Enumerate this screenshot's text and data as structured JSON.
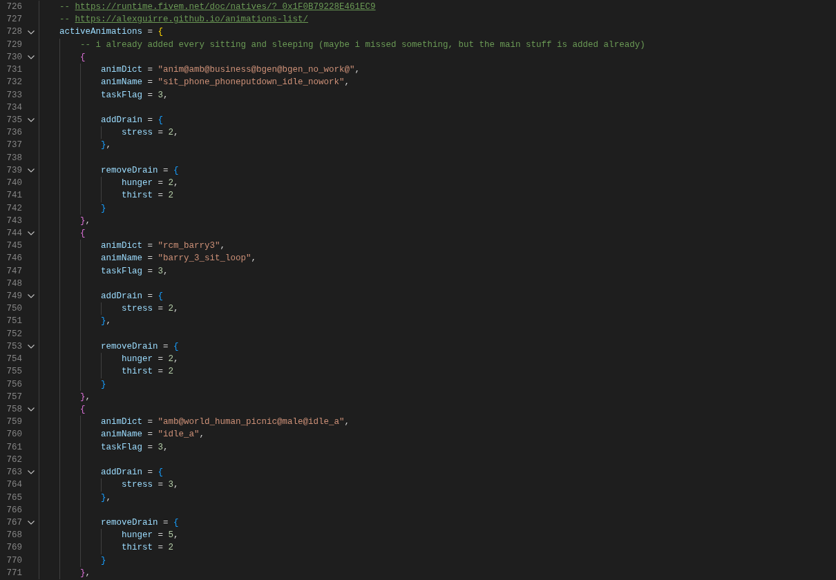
{
  "editor": {
    "lines": [
      {
        "number": "726",
        "foldable": false,
        "tokens": [
          {
            "kind": "comment",
            "text": "-- "
          },
          {
            "kind": "link",
            "text": "https://runtime.fivem.net/doc/natives/?_0x1F0B79228E461EC9"
          }
        ]
      },
      {
        "number": "727",
        "foldable": false,
        "tokens": [
          {
            "kind": "comment",
            "text": "-- "
          },
          {
            "kind": "link",
            "text": "https://alexguirre.github.io/animations-list/"
          }
        ]
      },
      {
        "number": "728",
        "foldable": true,
        "tokens": [
          {
            "kind": "key",
            "text": "activeAnimations"
          },
          {
            "kind": "op",
            "text": " = "
          },
          {
            "kind": "brace1",
            "text": "{"
          }
        ],
        "children": [
          {
            "number": "729",
            "foldable": false,
            "tokens": [
              {
                "kind": "comment",
                "text": "-- i already added every sitting and sleeping (maybe i missed something, but the main stuff is added already)"
              }
            ]
          },
          {
            "number": "730",
            "foldable": true,
            "tokens": [
              {
                "kind": "brace2",
                "text": "{"
              }
            ],
            "children": [
              {
                "number": "731",
                "foldable": false,
                "tokens": [
                  {
                    "kind": "key",
                    "text": "animDict"
                  },
                  {
                    "kind": "op",
                    "text": " = "
                  },
                  {
                    "kind": "string",
                    "text": "\"anim@amb@business@bgen@bgen_no_work@\""
                  },
                  {
                    "kind": "op",
                    "text": ","
                  }
                ]
              },
              {
                "number": "732",
                "foldable": false,
                "tokens": [
                  {
                    "kind": "key",
                    "text": "animName"
                  },
                  {
                    "kind": "op",
                    "text": " = "
                  },
                  {
                    "kind": "string",
                    "text": "\"sit_phone_phoneputdown_idle_nowork\""
                  },
                  {
                    "kind": "op",
                    "text": ","
                  }
                ]
              },
              {
                "number": "733",
                "foldable": false,
                "tokens": [
                  {
                    "kind": "key",
                    "text": "taskFlag"
                  },
                  {
                    "kind": "op",
                    "text": " = "
                  },
                  {
                    "kind": "number",
                    "text": "3"
                  },
                  {
                    "kind": "op",
                    "text": ","
                  }
                ]
              },
              {
                "number": "734",
                "foldable": false
              },
              {
                "number": "735",
                "foldable": true,
                "tokens": [
                  {
                    "kind": "key",
                    "text": "addDrain"
                  },
                  {
                    "kind": "op",
                    "text": " = "
                  },
                  {
                    "kind": "brace3",
                    "text": "{"
                  }
                ],
                "children": [
                  {
                    "number": "736",
                    "foldable": false,
                    "tokens": [
                      {
                        "kind": "key",
                        "text": "stress"
                      },
                      {
                        "kind": "op",
                        "text": " = "
                      },
                      {
                        "kind": "number",
                        "text": "2"
                      },
                      {
                        "kind": "op",
                        "text": ","
                      }
                    ]
                  }
                ]
              },
              {
                "number": "737",
                "foldable": false,
                "tokens": [
                  {
                    "kind": "brace3",
                    "text": "}"
                  },
                  {
                    "kind": "op",
                    "text": ","
                  }
                ]
              },
              {
                "number": "738",
                "foldable": false
              },
              {
                "number": "739",
                "foldable": true,
                "tokens": [
                  {
                    "kind": "key",
                    "text": "removeDrain"
                  },
                  {
                    "kind": "op",
                    "text": " = "
                  },
                  {
                    "kind": "brace3",
                    "text": "{"
                  }
                ],
                "children": [
                  {
                    "number": "740",
                    "foldable": false,
                    "tokens": [
                      {
                        "kind": "key",
                        "text": "hunger"
                      },
                      {
                        "kind": "op",
                        "text": " = "
                      },
                      {
                        "kind": "number",
                        "text": "2"
                      },
                      {
                        "kind": "op",
                        "text": ","
                      }
                    ]
                  },
                  {
                    "number": "741",
                    "foldable": false,
                    "tokens": [
                      {
                        "kind": "key",
                        "text": "thirst"
                      },
                      {
                        "kind": "op",
                        "text": " = "
                      },
                      {
                        "kind": "number",
                        "text": "2"
                      }
                    ]
                  }
                ]
              },
              {
                "number": "742",
                "foldable": false,
                "tokens": [
                  {
                    "kind": "brace3",
                    "text": "}"
                  }
                ]
              }
            ]
          },
          {
            "number": "743",
            "foldable": false,
            "tokens": [
              {
                "kind": "brace2",
                "text": "}"
              },
              {
                "kind": "op",
                "text": ","
              }
            ]
          },
          {
            "number": "744",
            "foldable": true,
            "tokens": [
              {
                "kind": "brace2",
                "text": "{"
              }
            ],
            "children": [
              {
                "number": "745",
                "foldable": false,
                "tokens": [
                  {
                    "kind": "key",
                    "text": "animDict"
                  },
                  {
                    "kind": "op",
                    "text": " = "
                  },
                  {
                    "kind": "string",
                    "text": "\"rcm_barry3\""
                  },
                  {
                    "kind": "op",
                    "text": ","
                  }
                ]
              },
              {
                "number": "746",
                "foldable": false,
                "tokens": [
                  {
                    "kind": "key",
                    "text": "animName"
                  },
                  {
                    "kind": "op",
                    "text": " = "
                  },
                  {
                    "kind": "string",
                    "text": "\"barry_3_sit_loop\""
                  },
                  {
                    "kind": "op",
                    "text": ","
                  }
                ]
              },
              {
                "number": "747",
                "foldable": false,
                "tokens": [
                  {
                    "kind": "key",
                    "text": "taskFlag"
                  },
                  {
                    "kind": "op",
                    "text": " = "
                  },
                  {
                    "kind": "number",
                    "text": "3"
                  },
                  {
                    "kind": "op",
                    "text": ","
                  }
                ]
              },
              {
                "number": "748",
                "foldable": false
              },
              {
                "number": "749",
                "foldable": true,
                "tokens": [
                  {
                    "kind": "key",
                    "text": "addDrain"
                  },
                  {
                    "kind": "op",
                    "text": " = "
                  },
                  {
                    "kind": "brace3",
                    "text": "{"
                  }
                ],
                "children": [
                  {
                    "number": "750",
                    "foldable": false,
                    "tokens": [
                      {
                        "kind": "key",
                        "text": "stress"
                      },
                      {
                        "kind": "op",
                        "text": " = "
                      },
                      {
                        "kind": "number",
                        "text": "2"
                      },
                      {
                        "kind": "op",
                        "text": ","
                      }
                    ]
                  }
                ]
              },
              {
                "number": "751",
                "foldable": false,
                "tokens": [
                  {
                    "kind": "brace3",
                    "text": "}"
                  },
                  {
                    "kind": "op",
                    "text": ","
                  }
                ]
              },
              {
                "number": "752",
                "foldable": false
              },
              {
                "number": "753",
                "foldable": true,
                "tokens": [
                  {
                    "kind": "key",
                    "text": "removeDrain"
                  },
                  {
                    "kind": "op",
                    "text": " = "
                  },
                  {
                    "kind": "brace3",
                    "text": "{"
                  }
                ],
                "children": [
                  {
                    "number": "754",
                    "foldable": false,
                    "tokens": [
                      {
                        "kind": "key",
                        "text": "hunger"
                      },
                      {
                        "kind": "op",
                        "text": " = "
                      },
                      {
                        "kind": "number",
                        "text": "2"
                      },
                      {
                        "kind": "op",
                        "text": ","
                      }
                    ]
                  },
                  {
                    "number": "755",
                    "foldable": false,
                    "tokens": [
                      {
                        "kind": "key",
                        "text": "thirst"
                      },
                      {
                        "kind": "op",
                        "text": " = "
                      },
                      {
                        "kind": "number",
                        "text": "2"
                      }
                    ]
                  }
                ]
              },
              {
                "number": "756",
                "foldable": false,
                "tokens": [
                  {
                    "kind": "brace3",
                    "text": "}"
                  }
                ]
              }
            ]
          },
          {
            "number": "757",
            "foldable": false,
            "tokens": [
              {
                "kind": "brace2",
                "text": "}"
              },
              {
                "kind": "op",
                "text": ","
              }
            ]
          },
          {
            "number": "758",
            "foldable": true,
            "tokens": [
              {
                "kind": "brace2",
                "text": "{"
              }
            ],
            "children": [
              {
                "number": "759",
                "foldable": false,
                "tokens": [
                  {
                    "kind": "key",
                    "text": "animDict"
                  },
                  {
                    "kind": "op",
                    "text": " = "
                  },
                  {
                    "kind": "string",
                    "text": "\"amb@world_human_picnic@male@idle_a\""
                  },
                  {
                    "kind": "op",
                    "text": ","
                  }
                ]
              },
              {
                "number": "760",
                "foldable": false,
                "tokens": [
                  {
                    "kind": "key",
                    "text": "animName"
                  },
                  {
                    "kind": "op",
                    "text": " = "
                  },
                  {
                    "kind": "string",
                    "text": "\"idle_a\""
                  },
                  {
                    "kind": "op",
                    "text": ","
                  }
                ]
              },
              {
                "number": "761",
                "foldable": false,
                "tokens": [
                  {
                    "kind": "key",
                    "text": "taskFlag"
                  },
                  {
                    "kind": "op",
                    "text": " = "
                  },
                  {
                    "kind": "number",
                    "text": "3"
                  },
                  {
                    "kind": "op",
                    "text": ","
                  }
                ]
              },
              {
                "number": "762",
                "foldable": false
              },
              {
                "number": "763",
                "foldable": true,
                "tokens": [
                  {
                    "kind": "key",
                    "text": "addDrain"
                  },
                  {
                    "kind": "op",
                    "text": " = "
                  },
                  {
                    "kind": "brace3",
                    "text": "{"
                  }
                ],
                "children": [
                  {
                    "number": "764",
                    "foldable": false,
                    "tokens": [
                      {
                        "kind": "key",
                        "text": "stress"
                      },
                      {
                        "kind": "op",
                        "text": " = "
                      },
                      {
                        "kind": "number",
                        "text": "3"
                      },
                      {
                        "kind": "op",
                        "text": ","
                      }
                    ]
                  }
                ]
              },
              {
                "number": "765",
                "foldable": false,
                "tokens": [
                  {
                    "kind": "brace3",
                    "text": "}"
                  },
                  {
                    "kind": "op",
                    "text": ","
                  }
                ]
              },
              {
                "number": "766",
                "foldable": false
              },
              {
                "number": "767",
                "foldable": true,
                "tokens": [
                  {
                    "kind": "key",
                    "text": "removeDrain"
                  },
                  {
                    "kind": "op",
                    "text": " = "
                  },
                  {
                    "kind": "brace3",
                    "text": "{"
                  }
                ],
                "children": [
                  {
                    "number": "768",
                    "foldable": false,
                    "tokens": [
                      {
                        "kind": "key",
                        "text": "hunger"
                      },
                      {
                        "kind": "op",
                        "text": " = "
                      },
                      {
                        "kind": "number",
                        "text": "5"
                      },
                      {
                        "kind": "op",
                        "text": ","
                      }
                    ]
                  },
                  {
                    "number": "769",
                    "foldable": false,
                    "tokens": [
                      {
                        "kind": "key",
                        "text": "thirst"
                      },
                      {
                        "kind": "op",
                        "text": " = "
                      },
                      {
                        "kind": "number",
                        "text": "2"
                      }
                    ]
                  }
                ]
              },
              {
                "number": "770",
                "foldable": false,
                "tokens": [
                  {
                    "kind": "brace3",
                    "text": "}"
                  }
                ]
              }
            ]
          },
          {
            "number": "771",
            "foldable": false,
            "tokens": [
              {
                "kind": "brace2",
                "text": "}"
              },
              {
                "kind": "op",
                "text": ","
              }
            ]
          }
        ]
      }
    ]
  }
}
